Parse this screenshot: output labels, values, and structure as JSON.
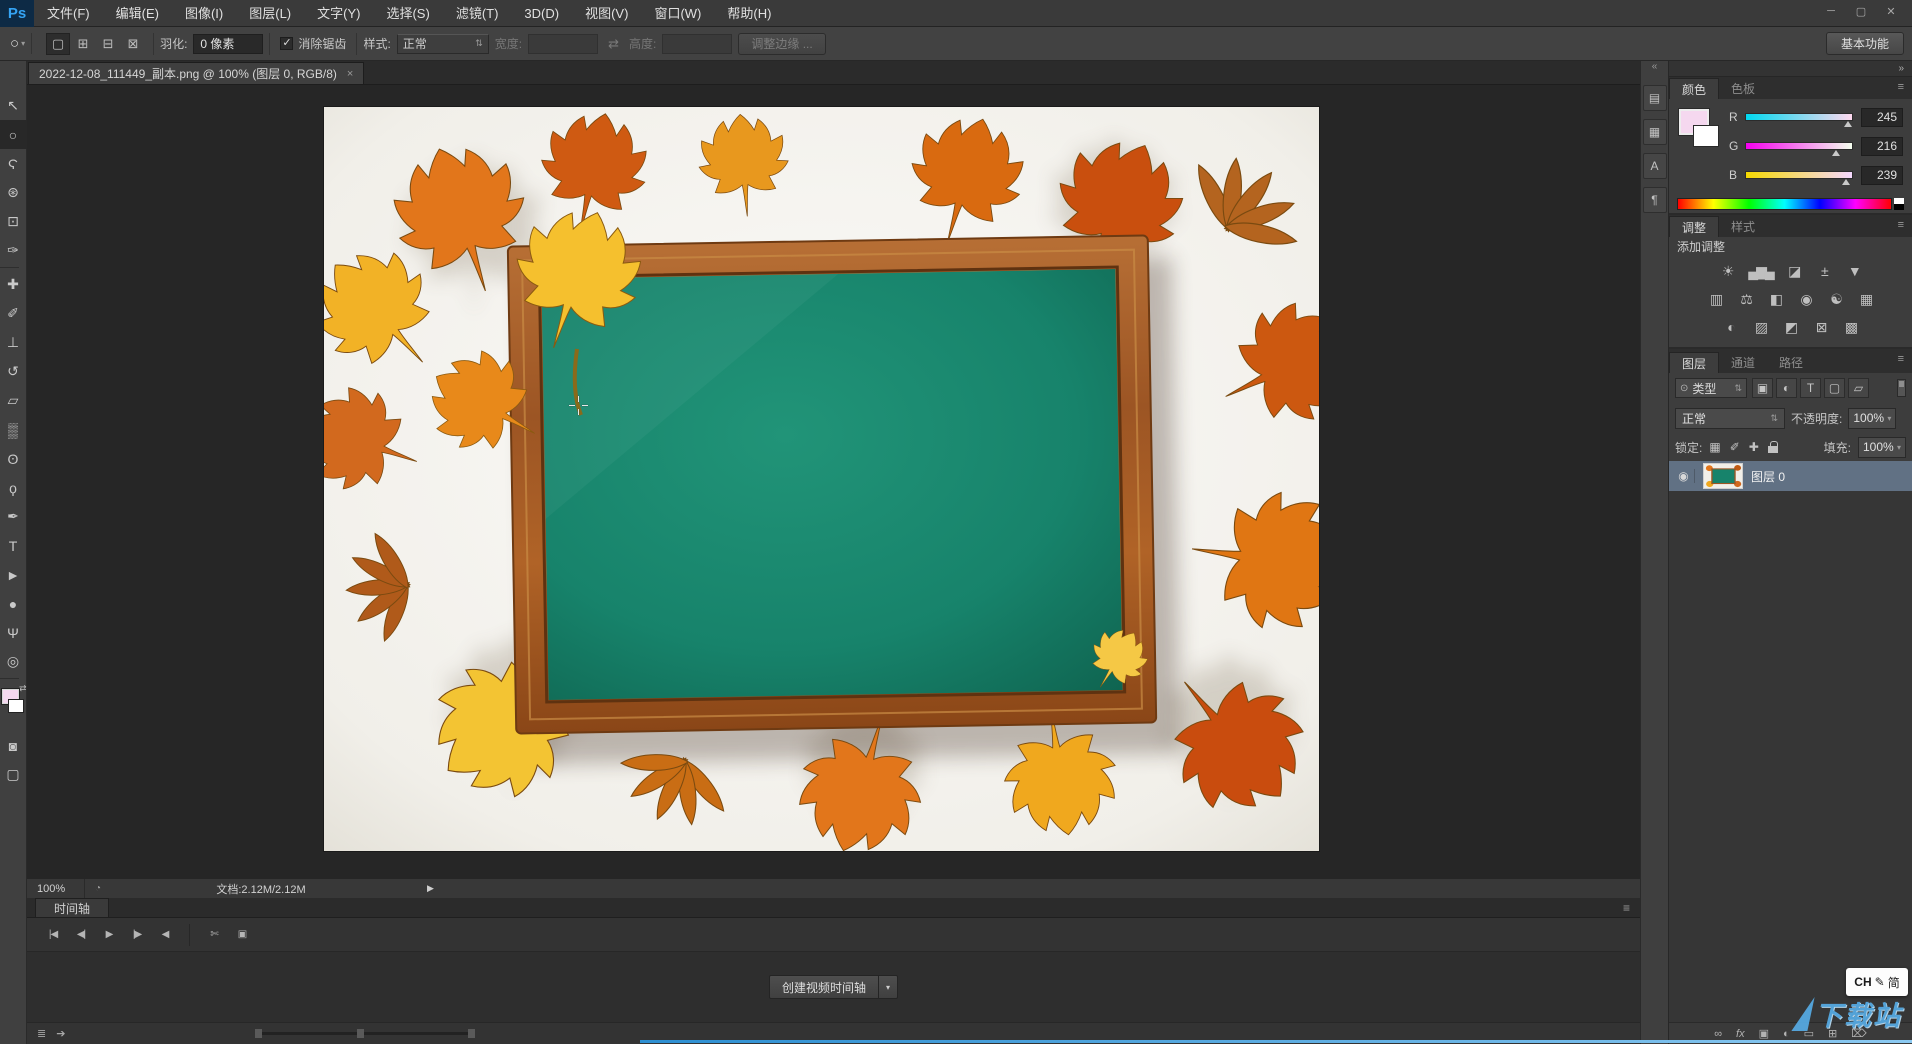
{
  "window": {
    "controls": [
      {
        "name": "minimize-button",
        "glyph": "─"
      },
      {
        "name": "restore-button",
        "glyph": "▢"
      },
      {
        "name": "close-button",
        "glyph": "✕"
      }
    ]
  },
  "menu": {
    "logo": "Ps",
    "items": [
      {
        "name": "menu-file",
        "label": "文件(F)"
      },
      {
        "name": "menu-edit",
        "label": "编辑(E)"
      },
      {
        "name": "menu-image",
        "label": "图像(I)"
      },
      {
        "name": "menu-layer",
        "label": "图层(L)"
      },
      {
        "name": "menu-type",
        "label": "文字(Y)"
      },
      {
        "name": "menu-select",
        "label": "选择(S)"
      },
      {
        "name": "menu-filter",
        "label": "滤镜(T)"
      },
      {
        "name": "menu-3d",
        "label": "3D(D)"
      },
      {
        "name": "menu-view",
        "label": "视图(V)"
      },
      {
        "name": "menu-window",
        "label": "窗口(W)"
      },
      {
        "name": "menu-help",
        "label": "帮助(H)"
      }
    ]
  },
  "options": {
    "tool_glyph": "○",
    "tool_dd": "▾",
    "mode_buttons": [
      {
        "name": "new-selection-mode",
        "glyph": "▢",
        "active": true
      },
      {
        "name": "add-to-selection-mode",
        "glyph": "⊞"
      },
      {
        "name": "subtract-from-selection-mode",
        "glyph": "⊟"
      },
      {
        "name": "intersect-selection-mode",
        "glyph": "⊠"
      }
    ],
    "feather_label": "羽化:",
    "feather_value": "0 像素",
    "antialias_check": "✓",
    "antialias_label": "消除锯齿",
    "style_label": "样式:",
    "style_value": "正常",
    "style_dd": "⇅",
    "width_label": "宽度:",
    "swap_glyph": "⇄",
    "height_label": "高度:",
    "refine_edge_label": "调整边缘 ...",
    "workspace_label": "基本功能"
  },
  "doc_tab": {
    "title": "2022-12-08_111449_副本.png @ 100% (图层 0, RGB/8)",
    "close": "×"
  },
  "toolbar": {
    "tools": [
      {
        "name": "move-tool",
        "glyph": "↖"
      },
      {
        "name": "elliptical-marquee-tool",
        "glyph": "○",
        "active": true
      },
      {
        "name": "lasso-tool",
        "glyph": "Ϛ"
      },
      {
        "name": "quick-selection-tool",
        "glyph": "⊛"
      },
      {
        "name": "crop-tool",
        "glyph": "⊡"
      },
      {
        "name": "eyedropper-tool",
        "glyph": "✑"
      },
      {
        "sep": true
      },
      {
        "name": "spot-healing-brush-tool",
        "glyph": "✚"
      },
      {
        "name": "brush-tool",
        "glyph": "✐"
      },
      {
        "name": "clone-stamp-tool",
        "glyph": "⊥"
      },
      {
        "name": "history-brush-tool",
        "glyph": "↺"
      },
      {
        "name": "eraser-tool",
        "glyph": "▱"
      },
      {
        "name": "gradient-tool",
        "glyph": "▒"
      },
      {
        "name": "blur-tool",
        "glyph": "ʘ"
      },
      {
        "name": "dodge-tool",
        "glyph": "ϙ"
      },
      {
        "name": "pen-tool",
        "glyph": "✒"
      },
      {
        "name": "type-tool",
        "glyph": "T"
      },
      {
        "name": "path-selection-tool",
        "glyph": "►"
      },
      {
        "name": "ellipse-shape-tool",
        "glyph": "●"
      },
      {
        "name": "hand-tool",
        "glyph": "Ψ"
      },
      {
        "name": "zoom-tool",
        "glyph": "◎"
      },
      {
        "sep": true
      }
    ],
    "swap_glyph": "⇄",
    "quick_mask_glyph": "◙",
    "screen_mode_glyph": "▢"
  },
  "statusbar": {
    "zoom": "100%",
    "clock_glyph": "◔",
    "doc": "文档:2.12M/2.12M",
    "arrow": "▶"
  },
  "timeline": {
    "tab": "时间轴",
    "menu_glyph": "≡",
    "transport": [
      {
        "name": "go-first-frame-button",
        "glyph": "|◀"
      },
      {
        "name": "prev-frame-button",
        "glyph": "◀|"
      },
      {
        "name": "play-button",
        "glyph": "▶"
      },
      {
        "name": "next-frame-button",
        "glyph": "|▶"
      },
      {
        "name": "audio-mute-button",
        "glyph": "◀"
      },
      {
        "sep": true
      },
      {
        "name": "split-clip-button",
        "glyph": "✄"
      },
      {
        "name": "transition-button",
        "glyph": "▣"
      }
    ],
    "create_button": "创建视频时间轴",
    "create_dd": "▾",
    "frame_animation_glyph": "≣",
    "render_glyph": "➔"
  },
  "dock": {
    "collapse": "«",
    "icons": [
      {
        "name": "history-panel-icon",
        "glyph": "▤"
      },
      {
        "name": "properties-panel-icon",
        "glyph": "▦"
      },
      {
        "name": "character-panel-icon",
        "glyph": "A"
      },
      {
        "name": "paragraph-panel-icon",
        "glyph": "¶"
      }
    ]
  },
  "panels": {
    "collapse_glyph": "»",
    "color": {
      "tabs": [
        {
          "name": "tab-color",
          "label": "颜色",
          "active": true
        },
        {
          "name": "tab-swatches",
          "label": "色板"
        }
      ],
      "menu_glyph": "≡",
      "channels": [
        {
          "label": "R",
          "value": "245",
          "from": "rgb(0,216,239)",
          "to": "rgb(255,216,239)"
        },
        {
          "label": "G",
          "value": "216",
          "from": "rgb(245,0,239)",
          "to": "rgb(245,255,239)"
        },
        {
          "label": "B",
          "value": "239",
          "from": "rgb(245,216,0)",
          "to": "rgb(245,216,255)"
        }
      ]
    },
    "adjustments": {
      "tabs": [
        {
          "name": "tab-adjustments",
          "label": "调整",
          "active": true
        },
        {
          "name": "tab-styles",
          "label": "样式"
        }
      ],
      "menu_glyph": "≡",
      "label": "添加调整",
      "row1": [
        {
          "name": "brightness-contrast-icon",
          "glyph": "☀"
        },
        {
          "name": "levels-icon",
          "glyph": "▄▆▄"
        },
        {
          "name": "curves-icon",
          "glyph": "◪"
        },
        {
          "name": "exposure-icon",
          "glyph": "±"
        },
        {
          "name": "vibrance-icon",
          "glyph": "▼"
        }
      ],
      "row2": [
        {
          "name": "hue-saturation-icon",
          "glyph": "▥"
        },
        {
          "name": "color-balance-icon",
          "glyph": "⚖"
        },
        {
          "name": "black-white-icon",
          "glyph": "◧"
        },
        {
          "name": "photo-filter-icon",
          "glyph": "◉"
        },
        {
          "name": "channel-mixer-icon",
          "glyph": "☯"
        },
        {
          "name": "color-lookup-icon",
          "glyph": "▦"
        }
      ],
      "row3": [
        {
          "name": "invert-icon",
          "glyph": "◐"
        },
        {
          "name": "posterize-icon",
          "glyph": "▨"
        },
        {
          "name": "threshold-icon",
          "glyph": "◩"
        },
        {
          "name": "gradient-map-icon",
          "glyph": "⊠"
        },
        {
          "name": "selective-color-icon",
          "glyph": "▩"
        }
      ]
    },
    "layers": {
      "tabs": [
        {
          "name": "tab-layers",
          "label": "图层",
          "active": true
        },
        {
          "name": "tab-channels",
          "label": "通道"
        },
        {
          "name": "tab-paths",
          "label": "路径"
        }
      ],
      "menu_glyph": "≡",
      "search_glyph": "⊙",
      "filter_label": "类型",
      "filter_dd": "⇅",
      "filter_icons": [
        {
          "name": "filter-pixel-layers-icon",
          "glyph": "▣"
        },
        {
          "name": "filter-adjustment-layers-icon",
          "glyph": "◐"
        },
        {
          "name": "filter-type-layers-icon",
          "glyph": "T"
        },
        {
          "name": "filter-shape-layers-icon",
          "glyph": "▢"
        },
        {
          "name": "filter-smart-objects-icon",
          "glyph": "▱"
        }
      ],
      "blend_value": "正常",
      "blend_dd": "⇅",
      "opacity_label": "不透明度:",
      "opacity_value": "100%",
      "opacity_dd": "▾",
      "lock_label": "锁定:",
      "lock_icons": [
        {
          "name": "lock-transparency-icon",
          "glyph": "▦"
        },
        {
          "name": "lock-paint-icon",
          "glyph": "✐"
        },
        {
          "name": "lock-position-icon",
          "glyph": "✚"
        },
        {
          "name": "lock-all-icon",
          "glyph": "",
          "cls": "css-lock"
        }
      ],
      "fill_label": "填充:",
      "fill_value": "100%",
      "fill_dd": "▾",
      "layer": {
        "eye_glyph": "◉",
        "name": "图层 0"
      },
      "bottom_icons": [
        {
          "name": "link-layers-icon",
          "glyph": "∞"
        },
        {
          "name": "layer-style-icon",
          "glyph": "fx"
        },
        {
          "name": "add-layer-mask-icon",
          "glyph": "▣"
        },
        {
          "name": "new-adjustment-layer-icon",
          "glyph": "◐"
        },
        {
          "name": "new-group-icon",
          "glyph": "▭"
        },
        {
          "name": "new-layer-icon",
          "glyph": "⊞"
        },
        {
          "name": "delete-layer-icon",
          "glyph": "⌦"
        }
      ]
    }
  },
  "ime": {
    "left": "CH",
    "mid": "✎",
    "right": "简"
  },
  "watermark": {
    "text": "下载站"
  },
  "colors": {
    "foreground_swatch": "#F5D8EF",
    "background_swatch": "#FFFFFF",
    "board_green": "#17836B",
    "wood_brown": "#A0572A",
    "selected_layer": "#617184",
    "watermark_blue": "#57AEE9"
  }
}
